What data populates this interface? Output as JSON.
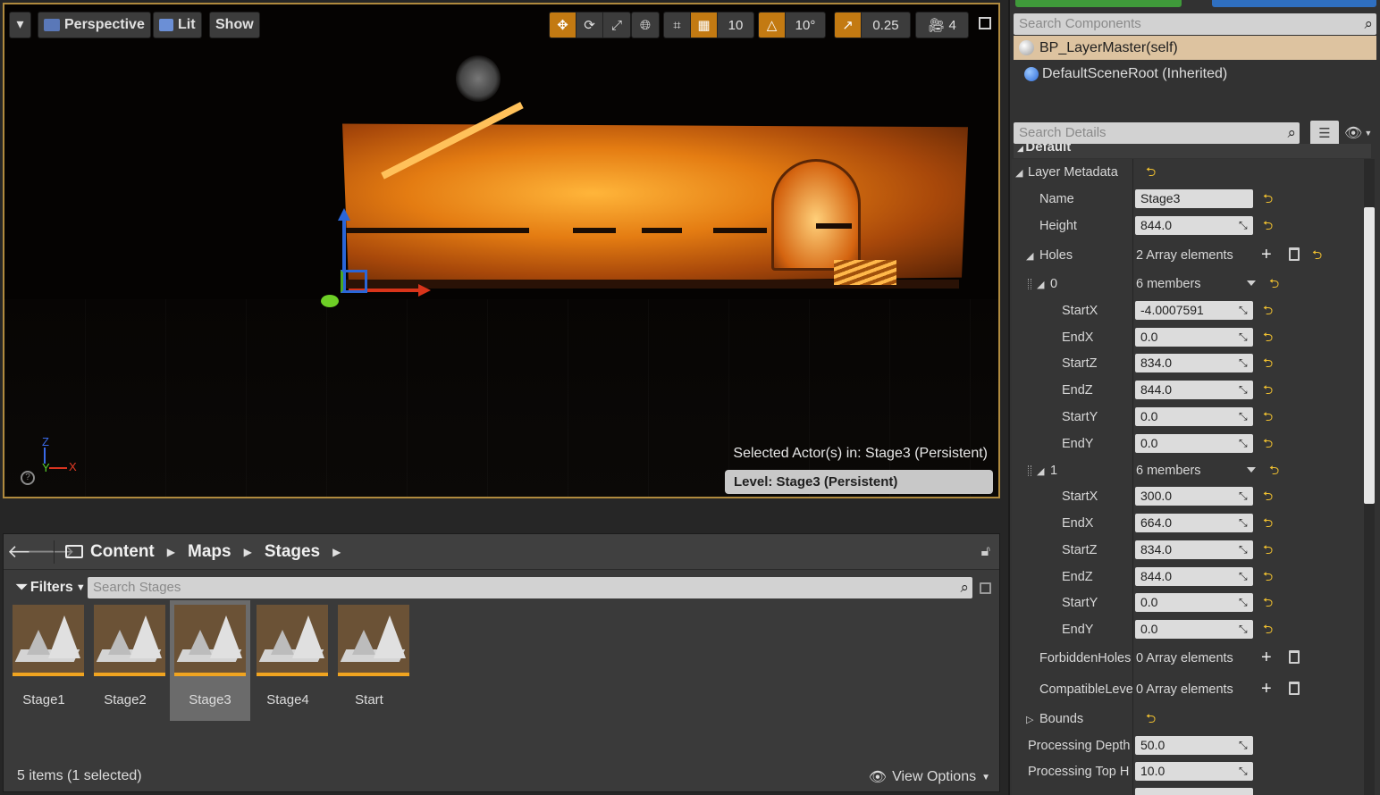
{
  "viewport": {
    "perspective_label": "Perspective",
    "lit_label": "Lit",
    "show_label": "Show",
    "grid_snap_value": "10",
    "rotation_snap_value": "10°",
    "scale_snap_value": "0.25",
    "camera_speed_value": "4",
    "selected_actor_text": "Selected Actor(s) in:  Stage3 (Persistent)",
    "level_text": "Level:  Stage3 (Persistent)",
    "axis_z": "Z",
    "axis_y": "Y",
    "axis_x": "X"
  },
  "content_browser": {
    "breadcrumb": [
      "Content",
      "Maps",
      "Stages"
    ],
    "filters_label": "Filters",
    "search_placeholder": "Search Stages",
    "assets": [
      "Stage1",
      "Stage2",
      "Stage3",
      "Stage4",
      "Start"
    ],
    "selected_asset": "Stage3",
    "status": "5 items (1 selected)",
    "view_options_label": "View Options"
  },
  "components": {
    "search_placeholder": "Search Components",
    "self_label": "BP_LayerMaster(self)",
    "root_label": "DefaultSceneRoot (Inherited)"
  },
  "details": {
    "search_placeholder": "Search Details",
    "category": "Default",
    "layer_metadata_label": "Layer Metadata",
    "name_label": "Name",
    "name_value": "Stage3",
    "height_label": "Height",
    "height_value": "844.0",
    "holes_label": "Holes",
    "holes_value": "2 Array elements",
    "hole0_index": "0",
    "hole0_members": "6 members",
    "hole0": [
      {
        "label": "StartX",
        "value": "-4.0007591"
      },
      {
        "label": "EndX",
        "value": "0.0"
      },
      {
        "label": "StartZ",
        "value": "834.0"
      },
      {
        "label": "EndZ",
        "value": "844.0"
      },
      {
        "label": "StartY",
        "value": "0.0"
      },
      {
        "label": "EndY",
        "value": "0.0"
      }
    ],
    "hole1_index": "1",
    "hole1_members": "6 members",
    "hole1": [
      {
        "label": "StartX",
        "value": "300.0"
      },
      {
        "label": "EndX",
        "value": "664.0"
      },
      {
        "label": "StartZ",
        "value": "834.0"
      },
      {
        "label": "EndZ",
        "value": "844.0"
      },
      {
        "label": "StartY",
        "value": "0.0"
      },
      {
        "label": "EndY",
        "value": "0.0"
      }
    ],
    "forbidden_label": "ForbiddenHoles",
    "forbidden_value": "0 Array elements",
    "compatible_label": "CompatibleLeve",
    "compatible_value": "0 Array elements",
    "bounds_label": "Bounds",
    "processing_depth_label": "Processing Depth",
    "processing_depth_value": "50.0",
    "processing_top_label": "Processing Top H",
    "processing_top_value": "10.0"
  },
  "colors": {
    "accent_orange": "#c37a12",
    "selected_row": "#ddc3a0",
    "viewport_border": "#b08a3e"
  }
}
